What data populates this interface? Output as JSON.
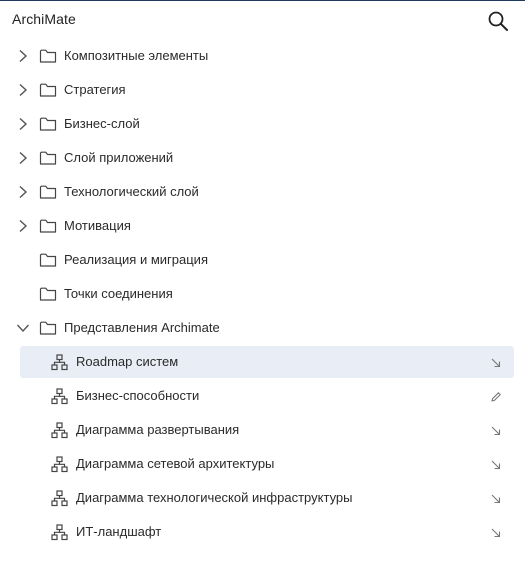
{
  "header": {
    "title": "ArchiMate",
    "search_icon": "search-icon"
  },
  "tree": {
    "folders": [
      {
        "label": "Композитные элементы",
        "expandable": true,
        "expanded": false
      },
      {
        "label": "Стратегия",
        "expandable": true,
        "expanded": false
      },
      {
        "label": "Бизнес-слой",
        "expandable": true,
        "expanded": false
      },
      {
        "label": "Слой приложений",
        "expandable": true,
        "expanded": false
      },
      {
        "label": "Технологический слой",
        "expandable": true,
        "expanded": false
      },
      {
        "label": "Мотивация",
        "expandable": true,
        "expanded": false
      },
      {
        "label": "Реализация и миграция",
        "expandable": false,
        "expanded": false
      },
      {
        "label": "Точки соединения",
        "expandable": false,
        "expanded": false
      },
      {
        "label": "Представления Archimate",
        "expandable": true,
        "expanded": true
      }
    ],
    "views": [
      {
        "label": "Roadmap систем",
        "action_icon": "pin-icon",
        "selected": true
      },
      {
        "label": "Бизнес-способности",
        "action_icon": "pencil-icon",
        "selected": false
      },
      {
        "label": "Диаграмма развертывания",
        "action_icon": "pin-icon",
        "selected": false
      },
      {
        "label": "Диаграмма сетевой архитектуры",
        "action_icon": "pin-icon",
        "selected": false
      },
      {
        "label": "Диаграмма технологической инфраструктуры",
        "action_icon": "pin-icon",
        "selected": false
      },
      {
        "label": "ИТ-ландшафт",
        "action_icon": "pin-icon",
        "selected": false
      }
    ]
  },
  "colors": {
    "selected_background": "#e9edf5",
    "icon_gray": "#666666",
    "text": "#2a2a2a"
  }
}
